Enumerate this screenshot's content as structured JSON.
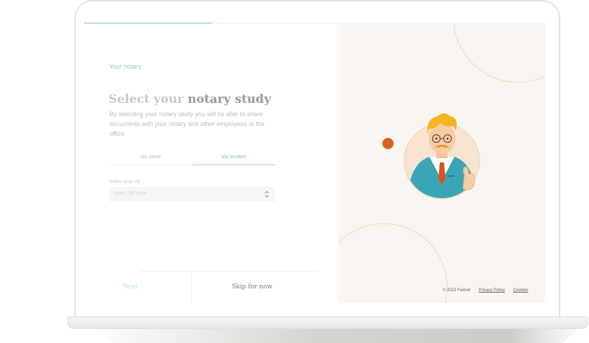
{
  "onboarding": {
    "progress_percent": 50,
    "step_label": "Your notary",
    "title_light": "Select your",
    "title_bold": "notary study",
    "description": "By selecting your notary study you will be able to share documents with your notary and other employees at the office.",
    "tabs": [
      {
        "label": "Via name",
        "active": false
      },
      {
        "label": "Via location",
        "active": true
      }
    ],
    "city_field": {
      "label": "Notary study city",
      "placeholder": "Enter ZIP code"
    },
    "next_label": "Next",
    "skip_label": "Skip for now"
  },
  "footer": {
    "copyright": "© 2022 Fednot",
    "privacy_label": "Privacy Policy",
    "cookies_label": "Cookies"
  },
  "colors": {
    "accent": "#8fc6d4",
    "highlight_dot": "#d85f1e",
    "panel_bg": "#f9f6f1"
  }
}
